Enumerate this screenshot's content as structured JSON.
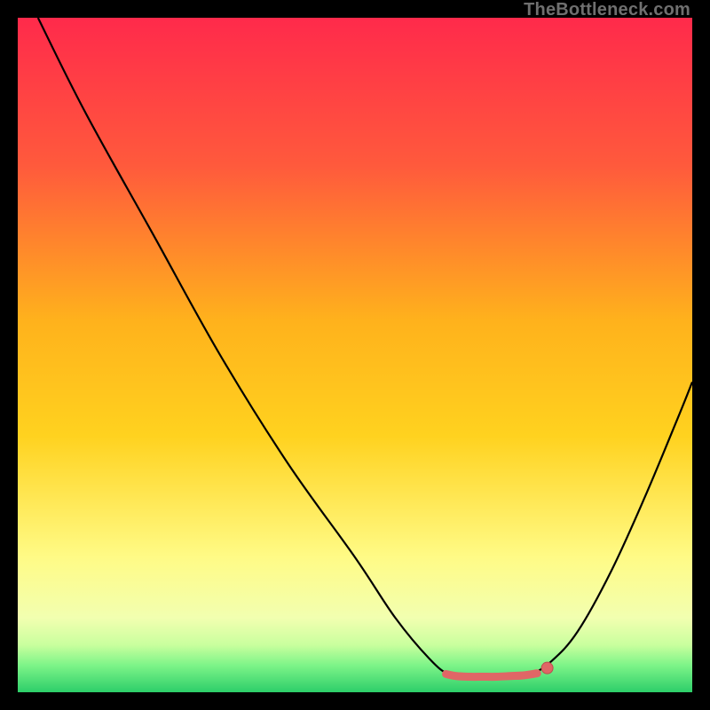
{
  "watermark": "TheBottleneck.com",
  "colors": {
    "frame": "#000000",
    "curve": "#000000",
    "marker_fill": "#e06666",
    "marker_stroke": "#bb4f4f",
    "gradient_top": "#ff2a4b",
    "gradient_mid_upper": "#ff6a3a",
    "gradient_mid": "#ffd21f",
    "gradient_mid_lower": "#fff77a",
    "gradient_low": "#ecffb3",
    "gradient_green1": "#a6ff8f",
    "gradient_green2": "#49e076",
    "gradient_green3": "#2dce6a"
  },
  "chart_data": {
    "type": "line",
    "title": "",
    "xlabel": "",
    "ylabel": "",
    "xlim": [
      0,
      100
    ],
    "ylim": [
      0,
      100
    ],
    "grid": false,
    "curve": [
      {
        "x": 3,
        "y": 100
      },
      {
        "x": 10,
        "y": 86
      },
      {
        "x": 20,
        "y": 68
      },
      {
        "x": 30,
        "y": 50
      },
      {
        "x": 40,
        "y": 34
      },
      {
        "x": 50,
        "y": 20
      },
      {
        "x": 56,
        "y": 11
      },
      {
        "x": 61,
        "y": 5
      },
      {
        "x": 64,
        "y": 2.6
      },
      {
        "x": 67,
        "y": 2.3
      },
      {
        "x": 70,
        "y": 2.3
      },
      {
        "x": 73,
        "y": 2.4
      },
      {
        "x": 76,
        "y": 2.7
      },
      {
        "x": 79,
        "y": 4.5
      },
      {
        "x": 83,
        "y": 9
      },
      {
        "x": 88,
        "y": 18
      },
      {
        "x": 93,
        "y": 29
      },
      {
        "x": 98,
        "y": 41
      },
      {
        "x": 100,
        "y": 46
      }
    ],
    "plateau": [
      {
        "x": 63.5,
        "y": 2.7
      },
      {
        "x": 65,
        "y": 2.4
      },
      {
        "x": 67,
        "y": 2.3
      },
      {
        "x": 69,
        "y": 2.3
      },
      {
        "x": 71,
        "y": 2.3
      },
      {
        "x": 73,
        "y": 2.4
      },
      {
        "x": 75,
        "y": 2.5
      },
      {
        "x": 77,
        "y": 2.8
      }
    ],
    "highlight_point": {
      "x": 78.5,
      "y": 3.6
    }
  }
}
